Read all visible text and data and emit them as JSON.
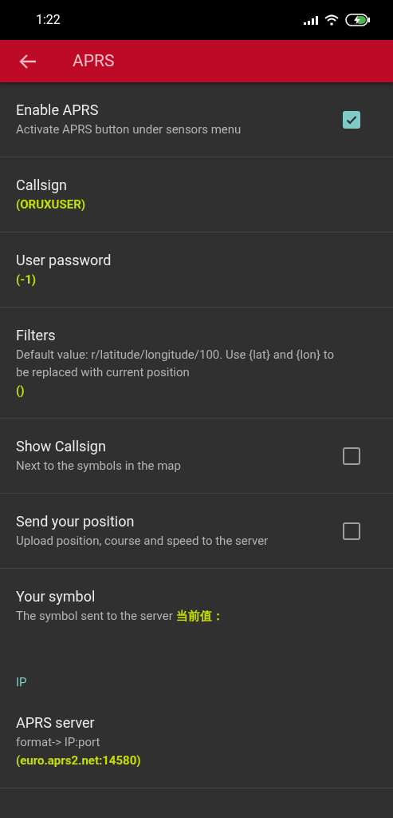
{
  "status_bar": {
    "time": "1:22"
  },
  "toolbar": {
    "title": "APRS"
  },
  "sections": [
    {
      "items": [
        {
          "kind": "checkbox",
          "title": "Enable APRS",
          "summary": "Activate APRS button under sensors menu",
          "checked": true,
          "divider": true
        },
        {
          "kind": "plain",
          "title": "Callsign",
          "value": "(ORUXUSER)",
          "divider": true
        },
        {
          "kind": "plain",
          "title": "User password",
          "value": "(-1)",
          "divider": true
        },
        {
          "kind": "plain",
          "title": "Filters",
          "summary": "Default value: r/latitude/longitude/100. Use {lat} and {lon} to be replaced with current position",
          "value": "()",
          "divider": true
        },
        {
          "kind": "checkbox",
          "title": "Show Callsign",
          "summary": "Next to the symbols in the map",
          "checked": false,
          "divider": true
        },
        {
          "kind": "checkbox",
          "title": "Send your position",
          "summary": "Upload position, course and speed to the server",
          "checked": false,
          "divider": true
        },
        {
          "kind": "plain",
          "title": "Your symbol",
          "summary": "The symbol sent to the server",
          "inline_value": "当前值：",
          "divider": false
        }
      ]
    },
    {
      "header": "IP",
      "items": [
        {
          "kind": "plain",
          "title": "APRS server",
          "summary": "format-> IP:port",
          "value": "(euro.aprs2.net:14580)",
          "divider": true
        }
      ]
    }
  ]
}
